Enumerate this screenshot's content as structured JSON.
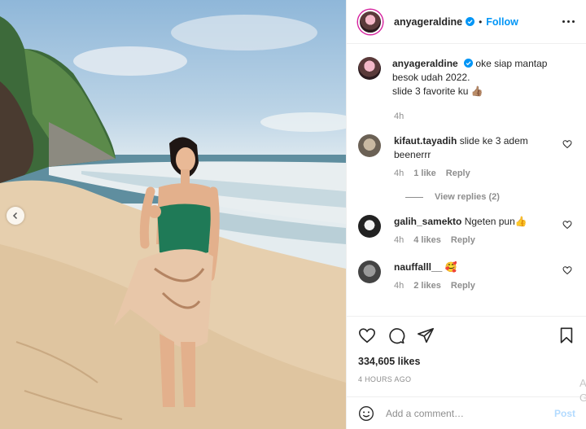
{
  "post": {
    "author": "anyageraldine",
    "follow_label": "Follow",
    "separator": "•"
  },
  "caption": {
    "username": "anyageraldine",
    "text_line1": "oke siap mantap besok udah 2022.",
    "text_line2": "slide 3 favorite ku",
    "emoji": "👍🏽",
    "time": "4h"
  },
  "comments": [
    {
      "username": "kifaut.tayadih",
      "text": "slide ke 3 adem beenerrr",
      "time": "4h",
      "likes": "1 like",
      "reply": "Reply",
      "view_replies": "View replies (2)"
    },
    {
      "username": "galih_samekto",
      "text": "Ngeten pun",
      "emoji": "👍",
      "time": "4h",
      "likes": "4 likes",
      "reply": "Reply"
    },
    {
      "username": "nauffalll__",
      "text": "",
      "emoji": "🥰",
      "time": "4h",
      "likes": "2 likes",
      "reply": "Reply"
    }
  ],
  "stats": {
    "likes": "334,605 likes",
    "posted": "4 hours ago"
  },
  "composer": {
    "placeholder": "Add a comment…",
    "post_label": "Post"
  },
  "ghost": "A G",
  "icons": {
    "verified": "verified-badge-icon",
    "more": "more-options-icon",
    "like": "heart-icon",
    "comment": "comment-bubble-icon",
    "share": "paper-plane-icon",
    "save": "bookmark-icon",
    "emoji": "smiley-icon",
    "prev": "chevron-left-icon"
  },
  "colors": {
    "accent": "#0095f6",
    "post_disabled": "#b3dbff",
    "muted": "#8e8e8e"
  }
}
